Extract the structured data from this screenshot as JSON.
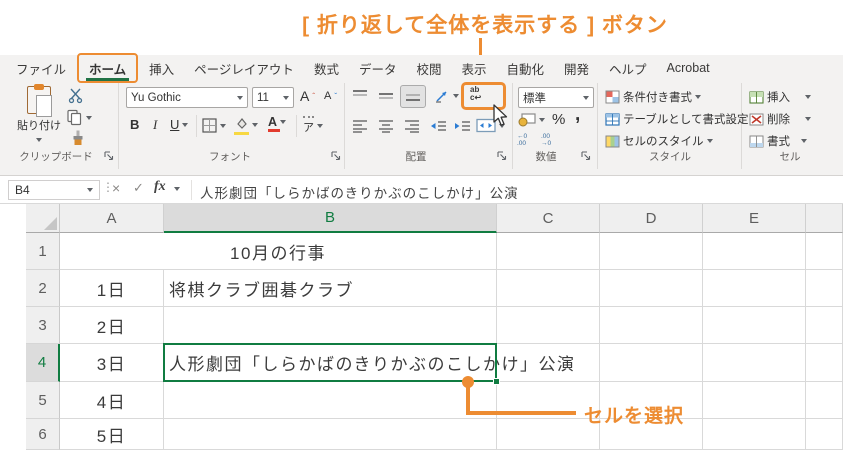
{
  "colors": {
    "accent_orange": "#ED8C32",
    "excel_green": "#217346",
    "selection_green": "#107C41"
  },
  "callouts": {
    "wrap_button": "[ 折り返して全体を表示する ] ボタン",
    "select_cell": "セルを選択"
  },
  "tabs": {
    "items": [
      "ファイル",
      "ホーム",
      "挿入",
      "ページレイアウト",
      "数式",
      "データ",
      "校閲",
      "表示",
      "自動化",
      "開発",
      "ヘルプ",
      "Acrobat"
    ],
    "active": "ホーム"
  },
  "ribbon": {
    "clipboard": {
      "paste_label": "貼り付け",
      "group_label": "クリップボード"
    },
    "font": {
      "name": "Yu Gothic",
      "size": "11",
      "bold": "B",
      "italic": "I",
      "underline": "U",
      "grow": "A",
      "shrink": "A",
      "ruby": "ア",
      "group_label": "フォント"
    },
    "alignment": {
      "wrap_line1": "ab",
      "wrap_line2": "c↩",
      "group_label": "配置"
    },
    "number": {
      "format": "標準",
      "percent": "%",
      "comma": ",",
      "inc_decimal": "←0\n.00",
      "dec_decimal": ".00\n→0",
      "group_label": "数値"
    },
    "styles": {
      "conditional_label": "条件付き書式",
      "table_label": "テーブルとして書式設定",
      "cell_styles_label": "セルのスタイル",
      "group_label": "スタイル"
    },
    "cells": {
      "insert_label": "挿入",
      "delete_label": "削除",
      "format_label": "書式",
      "group_label": "セル"
    }
  },
  "formula_bar": {
    "name_box": "B4",
    "cancel": "×",
    "enter": "✓",
    "fx_label": "fx",
    "dots": "⋮",
    "value": "人形劇団「しらかばのきりかぶのこしかけ」公演"
  },
  "sheet": {
    "col_headers": [
      "A",
      "B",
      "C",
      "D",
      "E"
    ],
    "selected_cell": "B4",
    "selected_column": "B",
    "rows": [
      {
        "num": "1",
        "a": "",
        "b": "10月の行事"
      },
      {
        "num": "2",
        "a": "1日",
        "b": "将棋クラブ囲碁クラブ"
      },
      {
        "num": "3",
        "a": "2日",
        "b": ""
      },
      {
        "num": "4",
        "a": "3日",
        "b": "人形劇団「しらかばのきりかぶのこしかけ」公演"
      },
      {
        "num": "5",
        "a": "4日",
        "b": ""
      },
      {
        "num": "6",
        "a": "5日",
        "b": ""
      }
    ]
  }
}
